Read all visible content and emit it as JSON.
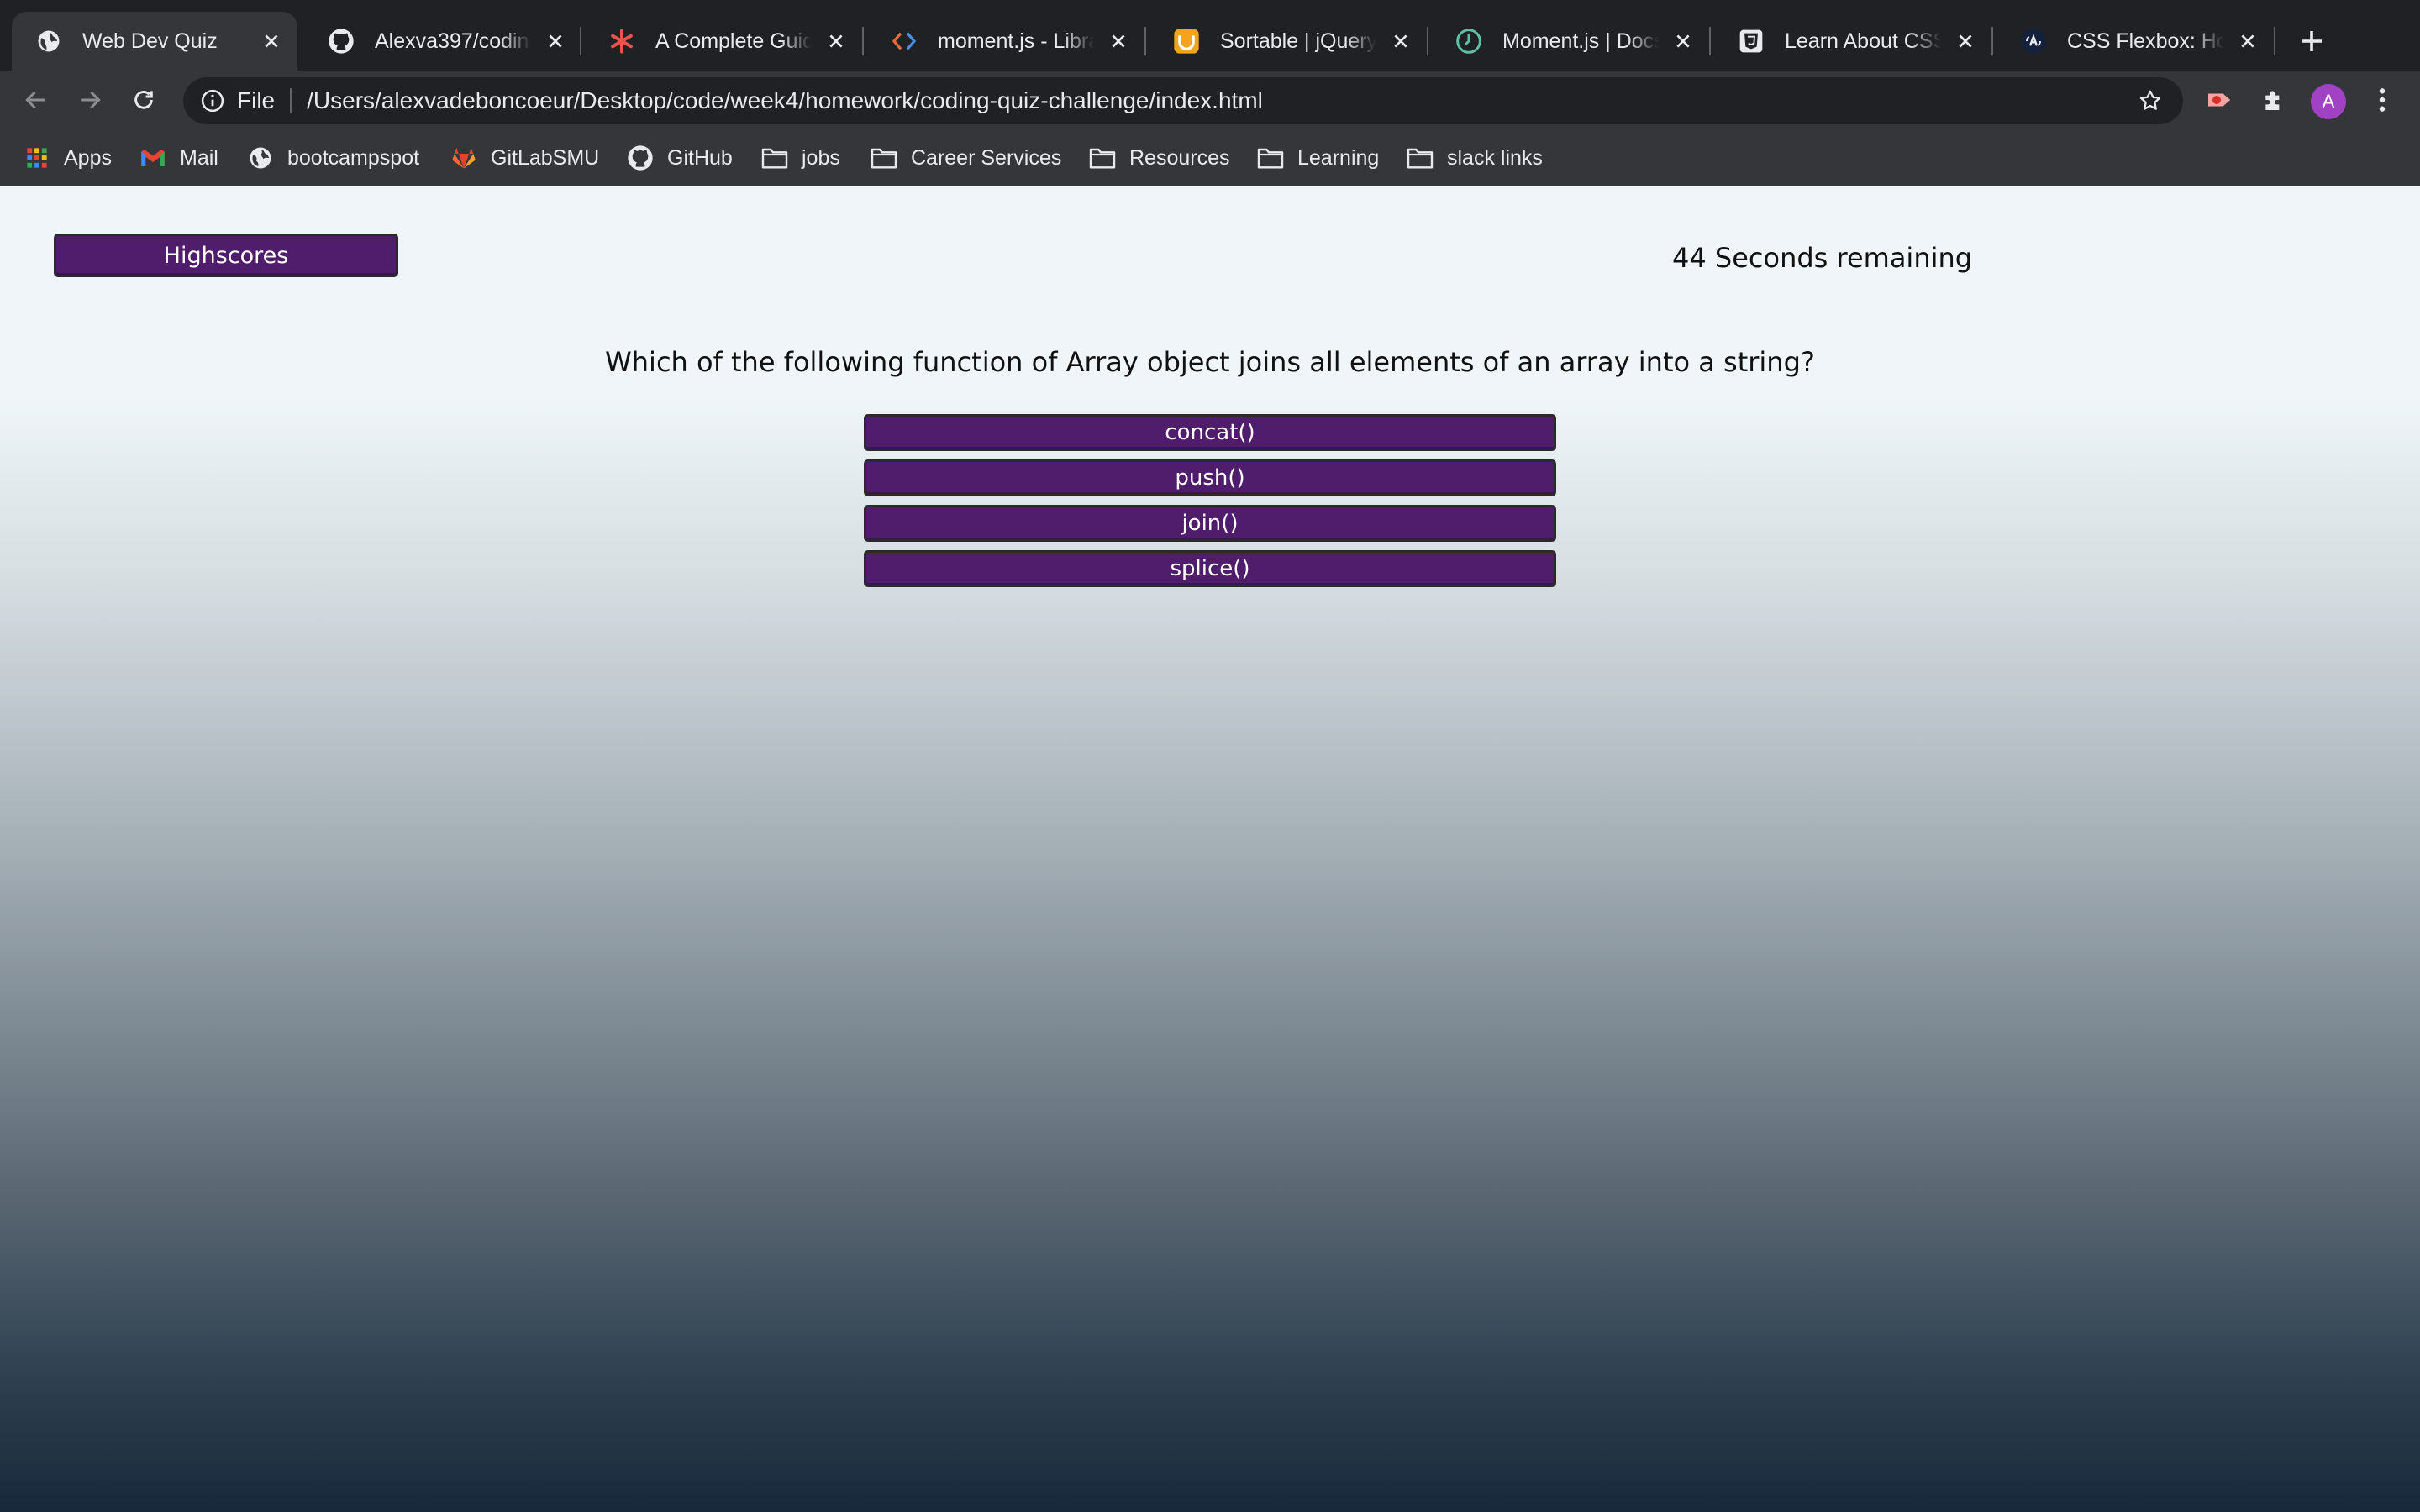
{
  "browser": {
    "tabs": [
      {
        "title": "Web Dev Quiz",
        "icon": "globe-icon",
        "active": true
      },
      {
        "title": "Alexva397/coding",
        "icon": "github-icon"
      },
      {
        "title": "A Complete Guide",
        "icon": "asterisk-icon"
      },
      {
        "title": "moment.js - Librar",
        "icon": "code-brackets-icon"
      },
      {
        "title": "Sortable | jQuery U",
        "icon": "jquery-ui-icon"
      },
      {
        "title": "Moment.js | Docs",
        "icon": "clock-icon"
      },
      {
        "title": "Learn About CSS I",
        "icon": "css-badge-icon"
      },
      {
        "title": "CSS Flexbox: How",
        "icon": "ka-logo-icon"
      }
    ],
    "omnibox": {
      "scheme_label": "File",
      "url": "/Users/alexvadeboncoeur/Desktop/code/week4/homework/coding-quiz-challenge/index.html"
    },
    "profile_initial": "A",
    "bookmarks": [
      {
        "label": "Apps",
        "icon": "apps-grid-icon"
      },
      {
        "label": "Mail",
        "icon": "gmail-icon"
      },
      {
        "label": "bootcampspot",
        "icon": "globe-icon"
      },
      {
        "label": "GitLabSMU",
        "icon": "gitlab-icon"
      },
      {
        "label": "GitHub",
        "icon": "github-icon"
      },
      {
        "label": "jobs",
        "icon": "folder-icon"
      },
      {
        "label": "Career Services",
        "icon": "folder-icon"
      },
      {
        "label": "Resources",
        "icon": "folder-icon"
      },
      {
        "label": "Learning",
        "icon": "folder-icon"
      },
      {
        "label": "slack links",
        "icon": "folder-icon"
      }
    ]
  },
  "quiz": {
    "highscores_label": "Highscores",
    "timer_text": "44 Seconds remaining",
    "question": "Which of the following function of Array object joins all elements of an array into a string?",
    "answers": [
      "concat()",
      "push()",
      "join()",
      "splice()"
    ]
  },
  "colors": {
    "button_purple": "#4f1d6b",
    "page_top": "#eff5f8",
    "page_bottom": "#17283a",
    "browser_dark": "#202124",
    "browser_toolbar": "#35363a"
  }
}
